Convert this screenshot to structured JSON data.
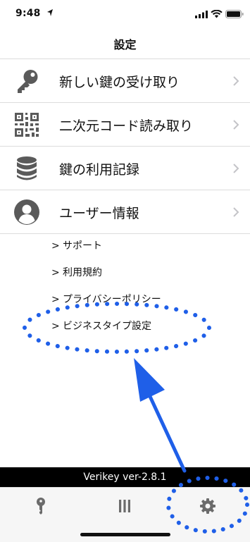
{
  "status_bar": {
    "time": "9:48"
  },
  "header": {
    "title": "設定"
  },
  "menu": {
    "items": [
      {
        "label": "新しい鍵の受け取り",
        "icon": "key-icon"
      },
      {
        "label": "二次元コード読み取り",
        "icon": "qr-code-icon"
      },
      {
        "label": "鍵の利用記録",
        "icon": "database-icon"
      },
      {
        "label": "ユーザー情報",
        "icon": "user-icon"
      }
    ]
  },
  "links": {
    "items": [
      {
        "prefix": ">",
        "label": "サポート"
      },
      {
        "prefix": ">",
        "label": "利用規約"
      },
      {
        "prefix": ">",
        "label": "プライバシーポリシー"
      },
      {
        "prefix": ">",
        "label": "ビジネスタイプ設定"
      }
    ]
  },
  "footer": {
    "version": "Verikey ver-2.8.1"
  },
  "tab_bar": {
    "tabs": [
      {
        "icon": "key-tab-icon"
      },
      {
        "icon": "list-tab-icon"
      },
      {
        "icon": "settings-gear-icon",
        "active": true
      }
    ]
  },
  "colors": {
    "annotation": "#1f5fe8",
    "chevron": "#c4c4c8",
    "icon": "#5a5a5a",
    "tab_icon": "#6b6b6b"
  }
}
